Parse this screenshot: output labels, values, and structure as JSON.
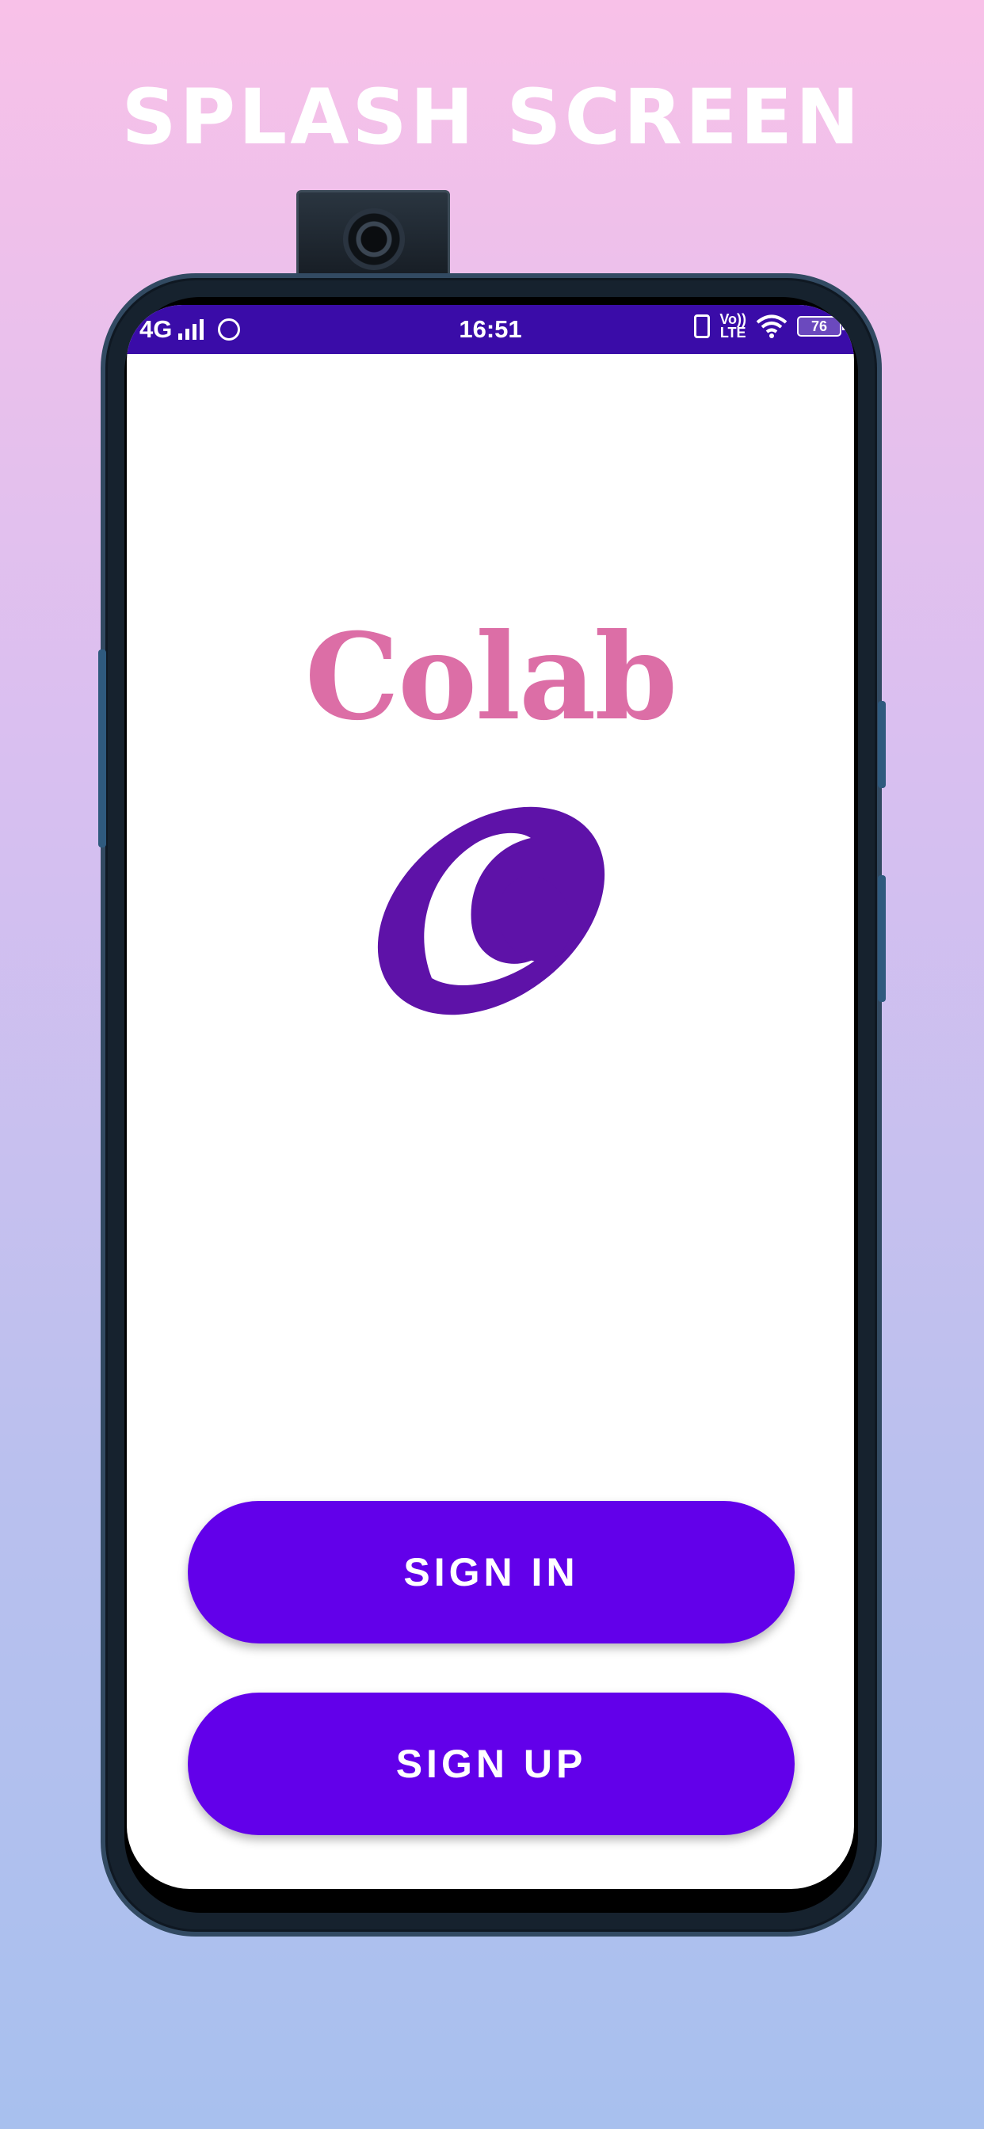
{
  "headline": "SPLASH SCREEN",
  "status_bar": {
    "network": "4G",
    "time": "16:51",
    "volte_top": "Vo))",
    "volte_bottom": "LTE",
    "battery": "76"
  },
  "app": {
    "logo_text": "Colab"
  },
  "buttons": {
    "sign_in": "SIGN IN",
    "sign_up": "SIGN UP"
  },
  "colors": {
    "accent": "#6200ea",
    "status_bar": "#3a0ca8",
    "logo_text": "#dc6ea6",
    "logo_mark": "#5e12a8"
  }
}
